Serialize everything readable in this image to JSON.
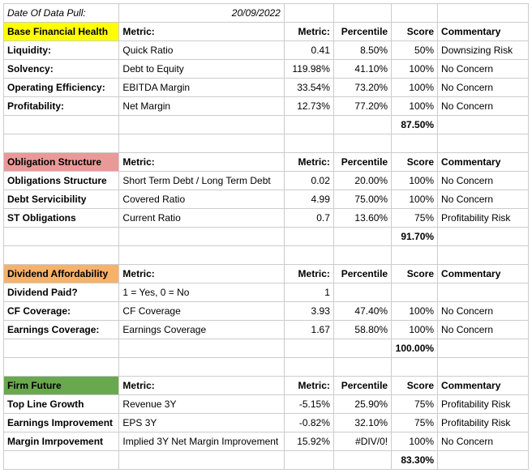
{
  "header": {
    "date_label": "Date Of Data Pull:",
    "date_value": "20/09/2022"
  },
  "columns": {
    "metric_label": "Metric:",
    "metric_col": "Metric:",
    "percentile": "Percentile",
    "score": "Score",
    "commentary": "Commentary"
  },
  "sections": [
    {
      "title": "Base Financial Health",
      "highlight": "hl-yellow",
      "rows": [
        {
          "cat": "Liquidity:",
          "metric": "Quick Ratio",
          "val": "0.41",
          "pct": "8.50%",
          "score": "50%",
          "comm": "Downsizing Risk"
        },
        {
          "cat": "Solvency:",
          "metric": "Debt to Equity",
          "val": "119.98%",
          "pct": "41.10%",
          "score": "100%",
          "comm": "No Concern"
        },
        {
          "cat": "Operating Efficiency:",
          "metric": "EBITDA Margin",
          "val": "33.54%",
          "pct": "73.20%",
          "score": "100%",
          "comm": "No Concern"
        },
        {
          "cat": "Profitability:",
          "metric": "Net Margin",
          "val": "12.73%",
          "pct": "77.20%",
          "score": "100%",
          "comm": "No Concern"
        }
      ],
      "total": "87.50%"
    },
    {
      "title": "Obligation Structure",
      "highlight": "hl-red",
      "rows": [
        {
          "cat": "Obligations Structure",
          "metric": "Short Term Debt / Long Term Debt",
          "val": "0.02",
          "pct": "20.00%",
          "score": "100%",
          "comm": "No Concern"
        },
        {
          "cat": "Debt Servicibility",
          "metric": "Covered Ratio",
          "val": "4.99",
          "pct": "75.00%",
          "score": "100%",
          "comm": "No Concern"
        },
        {
          "cat": "ST Obligations",
          "metric": "Current Ratio",
          "val": "0.7",
          "pct": "13.60%",
          "score": "75%",
          "comm": "Profitability Risk"
        }
      ],
      "total": "91.70%"
    },
    {
      "title": "Dividend Affordability",
      "highlight": "hl-orange",
      "rows": [
        {
          "cat": "Dividend Paid?",
          "metric": "1 = Yes, 0 = No",
          "val": "1",
          "pct": "",
          "score": "",
          "comm": ""
        },
        {
          "cat": "CF Coverage:",
          "metric": "CF Coverage",
          "val": "3.93",
          "pct": "47.40%",
          "score": "100%",
          "comm": "No Concern"
        },
        {
          "cat": "Earnings Coverage:",
          "metric": "Earnings Coverage",
          "val": "1.67",
          "pct": "58.80%",
          "score": "100%",
          "comm": "No Concern"
        }
      ],
      "total": "100.00%"
    },
    {
      "title": "Firm Future",
      "highlight": "hl-green",
      "rows": [
        {
          "cat": "Top Line Growth",
          "metric": "Revenue 3Y",
          "val": "-5.15%",
          "pct": "25.90%",
          "score": "75%",
          "comm": "Profitability Risk"
        },
        {
          "cat": "Earnings Improvement",
          "metric": "EPS 3Y",
          "val": "-0.82%",
          "pct": "32.10%",
          "score": "75%",
          "comm": "Profitability Risk"
        },
        {
          "cat": "Margin Imrpovement",
          "metric": "Implied 3Y Net Margin Improvement",
          "val": "15.92%",
          "pct": "#DIV/0!",
          "score": "100%",
          "comm": "No Concern"
        }
      ],
      "total": "83.30%"
    }
  ]
}
